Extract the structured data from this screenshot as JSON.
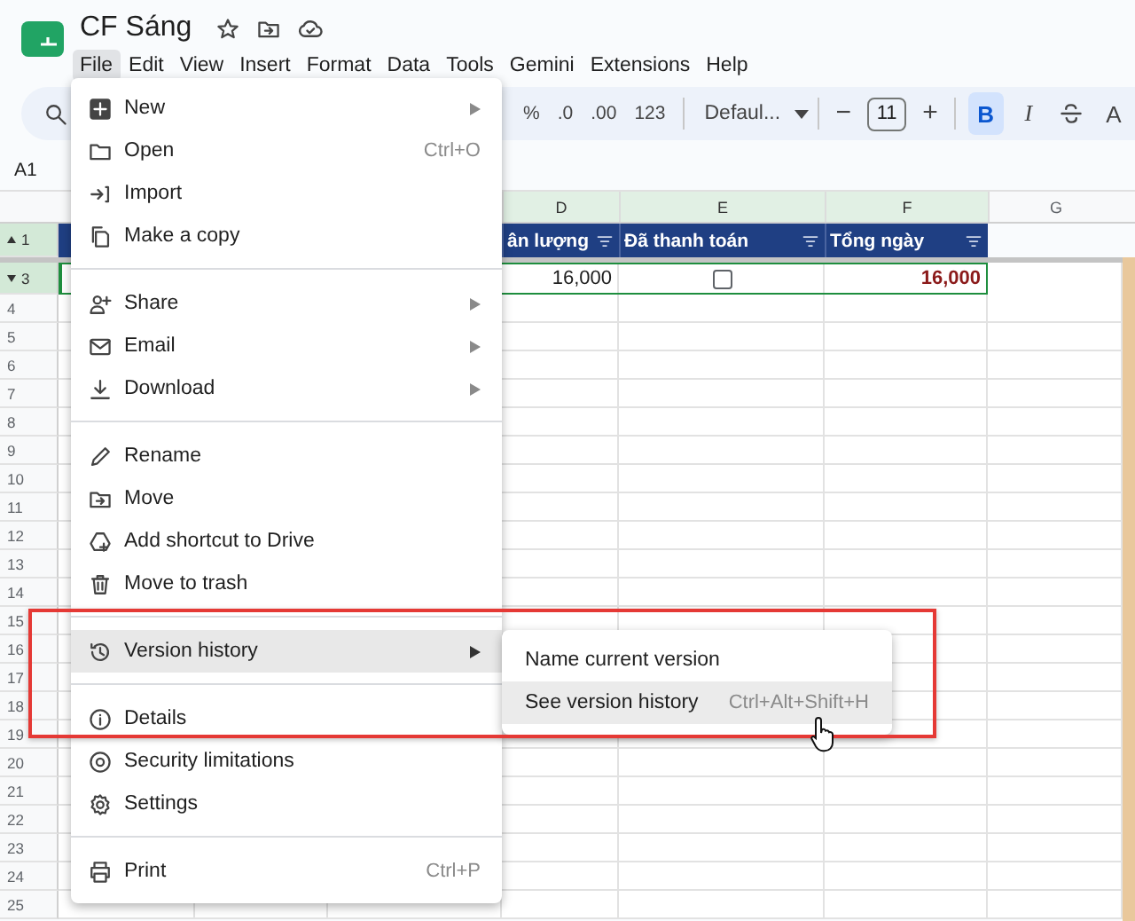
{
  "document": {
    "title": "CF Sáng"
  },
  "menubar": [
    {
      "label": "File",
      "selected": true
    },
    {
      "label": "Edit",
      "selected": false
    },
    {
      "label": "View",
      "selected": false
    },
    {
      "label": "Insert",
      "selected": false
    },
    {
      "label": "Format",
      "selected": false
    },
    {
      "label": "Data",
      "selected": false
    },
    {
      "label": "Tools",
      "selected": false
    },
    {
      "label": "Gemini",
      "selected": false
    },
    {
      "label": "Extensions",
      "selected": false
    },
    {
      "label": "Help",
      "selected": false
    }
  ],
  "toolbar": {
    "number_buttons": [
      "%",
      ".0",
      ".00",
      "123"
    ],
    "font": "Defaul...",
    "size_minus": "−",
    "font_size": "11",
    "size_plus": "+",
    "style_buttons": [
      {
        "kind": "bold",
        "label": "B",
        "selected": true
      },
      {
        "kind": "italic",
        "label": "I",
        "selected": false
      },
      {
        "kind": "strikethrough",
        "selected": false
      },
      {
        "kind": "text_color",
        "label": "A",
        "selected": false
      }
    ]
  },
  "name_box": "A1",
  "sheet": {
    "columns": [
      {
        "label": "D",
        "selected": true
      },
      {
        "label": "E",
        "selected": true
      },
      {
        "label": "F",
        "selected": true
      },
      {
        "label": "G",
        "selected": false
      }
    ],
    "header_row": [
      {
        "text": "ân lượng",
        "filter": true
      },
      {
        "text": "Đã thanh toán",
        "filter": true
      },
      {
        "text": "Tổng ngày",
        "filter": true
      }
    ],
    "data_row": [
      {
        "kind": "number",
        "text": "16,000"
      },
      {
        "kind": "checkbox",
        "checked": false
      },
      {
        "kind": "total",
        "text": "16,000"
      }
    ],
    "row_numbers": [
      {
        "kind": "group_top",
        "label": "1",
        "selected": true
      },
      {
        "kind": "group_bottom",
        "label": "3",
        "selected": true
      },
      {
        "kind": "plain",
        "label": "4",
        "selected": false
      },
      {
        "kind": "plain",
        "label": "5",
        "selected": false
      },
      {
        "kind": "plain",
        "label": "6",
        "selected": false
      },
      {
        "kind": "plain",
        "label": "7",
        "selected": false
      },
      {
        "kind": "plain",
        "label": "8",
        "selected": false
      },
      {
        "kind": "plain",
        "label": "9",
        "selected": false
      },
      {
        "kind": "plain",
        "label": "10",
        "selected": false
      },
      {
        "kind": "plain",
        "label": "11",
        "selected": false
      },
      {
        "kind": "plain",
        "label": "12",
        "selected": false
      },
      {
        "kind": "plain",
        "label": "13",
        "selected": false
      },
      {
        "kind": "plain",
        "label": "14",
        "selected": false
      },
      {
        "kind": "plain",
        "label": "15",
        "selected": false
      },
      {
        "kind": "plain",
        "label": "16",
        "selected": false
      },
      {
        "kind": "plain",
        "label": "17",
        "selected": false
      },
      {
        "kind": "plain",
        "label": "18",
        "selected": false
      },
      {
        "kind": "plain",
        "label": "19",
        "selected": false
      },
      {
        "kind": "plain",
        "label": "20",
        "selected": false
      },
      {
        "kind": "plain",
        "label": "21",
        "selected": false
      },
      {
        "kind": "plain",
        "label": "22",
        "selected": false
      },
      {
        "kind": "plain",
        "label": "23",
        "selected": false
      },
      {
        "kind": "plain",
        "label": "24",
        "selected": false
      },
      {
        "kind": "plain",
        "label": "25",
        "selected": false
      }
    ]
  },
  "file_menu": [
    {
      "label": "New",
      "submenu": true,
      "selected": false
    },
    {
      "label": "Open",
      "shortcut": "Ctrl+O",
      "selected": false
    },
    {
      "label": "Import",
      "selected": false
    },
    {
      "label": "Make a copy",
      "selected": false,
      "divider_after": true
    },
    {
      "label": "Share",
      "submenu": true,
      "selected": false
    },
    {
      "label": "Email",
      "submenu": true,
      "selected": false
    },
    {
      "label": "Download",
      "submenu": true,
      "selected": false,
      "divider_after": true
    },
    {
      "label": "Rename",
      "selected": false
    },
    {
      "label": "Move",
      "selected": false
    },
    {
      "label": "Add shortcut to Drive",
      "selected": false
    },
    {
      "label": "Move to trash",
      "selected": false,
      "divider_after": true
    },
    {
      "label": "Version history",
      "submenu": true,
      "selected": true,
      "divider_after": true
    },
    {
      "label": "Details",
      "selected": false
    },
    {
      "label": "Security limitations",
      "selected": false
    },
    {
      "label": "Settings",
      "selected": false,
      "divider_after": true
    },
    {
      "label": "Print",
      "shortcut": "Ctrl+P",
      "selected": false
    }
  ],
  "version_submenu": [
    {
      "label": "Name current version",
      "selected": false
    },
    {
      "label": "See version history",
      "shortcut": "Ctrl+Alt+Shift+H",
      "selected": true
    }
  ]
}
